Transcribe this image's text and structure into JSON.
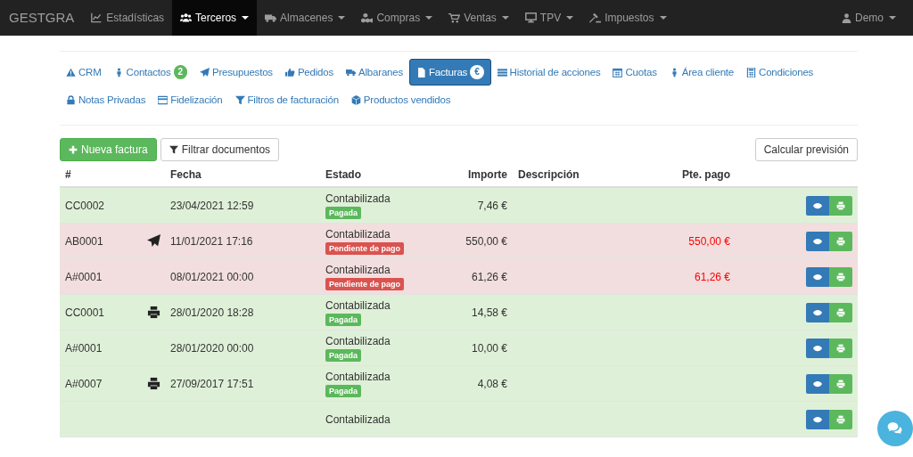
{
  "navbar": {
    "brand": "GESTGRA",
    "items": [
      {
        "label": "Estadísticas",
        "dropdown": false,
        "selected": false
      },
      {
        "label": "Terceros",
        "dropdown": true,
        "selected": true
      },
      {
        "label": "Almacenes",
        "dropdown": true,
        "selected": false
      },
      {
        "label": "Compras",
        "dropdown": true,
        "selected": false
      },
      {
        "label": "Ventas",
        "dropdown": true,
        "selected": false
      },
      {
        "label": "TPV",
        "dropdown": true,
        "selected": false
      },
      {
        "label": "Impuestos",
        "dropdown": true,
        "selected": false
      }
    ],
    "user": "Demo"
  },
  "tabs": [
    {
      "label": "CRM",
      "selected": false
    },
    {
      "label": "Contactos",
      "badge": "2",
      "selected": false
    },
    {
      "label": "Presupuestos",
      "selected": false
    },
    {
      "label": "Pedidos",
      "selected": false
    },
    {
      "label": "Albaranes",
      "selected": false
    },
    {
      "label": "Facturas",
      "badge": "€",
      "selected": true
    },
    {
      "label": "Historial de acciones",
      "selected": false
    },
    {
      "label": "Cuotas",
      "selected": false
    },
    {
      "label": "Área cliente",
      "selected": false
    },
    {
      "label": "Condiciones",
      "selected": false
    },
    {
      "label": "Notas Privadas",
      "selected": false
    },
    {
      "label": "Fidelización",
      "selected": false
    },
    {
      "label": "Filtros de facturación",
      "selected": false
    },
    {
      "label": "Productos vendidos",
      "selected": false
    }
  ],
  "toolbar": {
    "new_button": "Nueva factura",
    "filter_button": "Filtrar documentos",
    "forecast_button": "Calcular previsión"
  },
  "table": {
    "columns": [
      "#",
      "Fecha",
      "Estado",
      "Importe",
      "Descripción",
      "Pte. pago"
    ],
    "rows": [
      {
        "code": "CC0002",
        "sent": false,
        "printed": false,
        "date": "23/04/2021 12:59",
        "state": "Contabilizada",
        "paid": true,
        "status_label": "Pagada",
        "amount": "7,46 €"
      },
      {
        "code": "AB0001",
        "sent": true,
        "printed": false,
        "date": "11/01/2021 17:16",
        "state": "Contabilizada",
        "paid": false,
        "status_label": "Pendiente de pago",
        "amount": "550,00 €",
        "pending": "550,00 €"
      },
      {
        "code": "A#0001",
        "sent": false,
        "printed": false,
        "date": "08/01/2021 00:00",
        "state": "Contabilizada",
        "paid": false,
        "status_label": "Pendiente de pago",
        "amount": "61,26 €",
        "pending": "61,26 €"
      },
      {
        "code": "CC0001",
        "sent": false,
        "printed": true,
        "date": "28/01/2020 18:28",
        "state": "Contabilizada",
        "paid": true,
        "status_label": "Pagada",
        "amount": "14,58 €"
      },
      {
        "code": "A#0001",
        "sent": false,
        "printed": false,
        "date": "28/01/2020 00:00",
        "state": "Contabilizada",
        "paid": true,
        "status_label": "Pagada",
        "amount": "10,00 €"
      },
      {
        "code": "A#0007",
        "sent": false,
        "printed": true,
        "date": "27/09/2017 17:51",
        "state": "Contabilizada",
        "paid": true,
        "status_label": "Pagada",
        "amount": "4,08 €"
      },
      {
        "sent": false,
        "printed": false,
        "state": "Contabilizada",
        "paid": true
      }
    ]
  }
}
